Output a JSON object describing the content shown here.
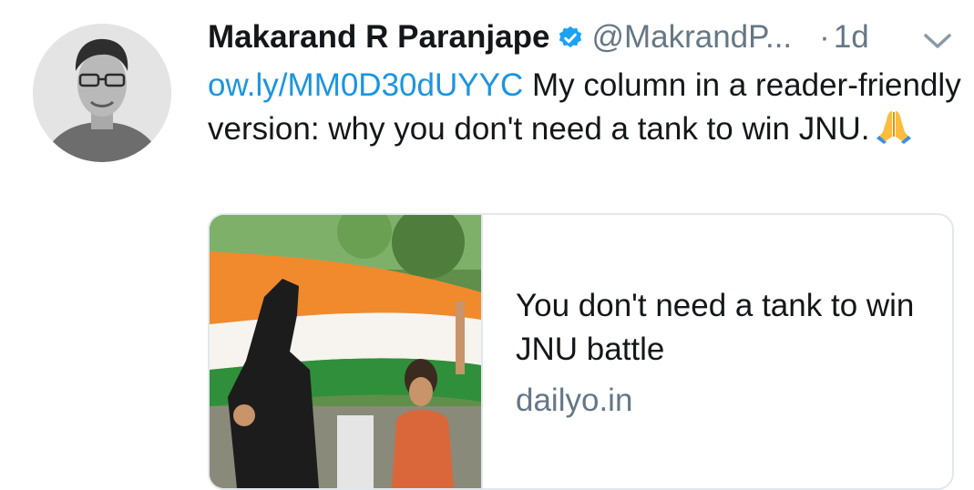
{
  "tweet": {
    "author_name": "Makarand R Paranjape",
    "handle": "@MakrandP...",
    "separator": "·",
    "time": "1d",
    "text_link": "ow.ly/MM0D30dUYYC",
    "text_body": " My column in a reader-friendly version: why you don't need a tank to win JNU.",
    "emoji": "folded-hands-icon",
    "icons": {
      "verified": "verified-badge-icon",
      "caret": "chevron-down-icon"
    }
  },
  "card": {
    "title": "You don't need a tank to win JNU battle",
    "domain": "dailyo.in",
    "image": "flag-rally-photo"
  },
  "colors": {
    "link": "#1b95e0",
    "secondary_text": "#657786",
    "primary_text": "#14171a",
    "verified": "#1da1f2",
    "border": "#e1e8ed"
  }
}
